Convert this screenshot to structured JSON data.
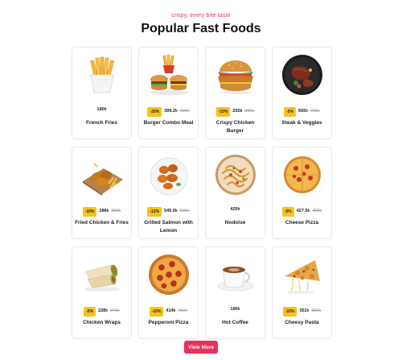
{
  "header": {
    "tagline": "crispy, every bite taste",
    "title": "Popular Fast Foods"
  },
  "products": [
    {
      "name": "French Fries",
      "badge": "",
      "price": "180৳",
      "old_price": "",
      "icon": "fries-image"
    },
    {
      "name": "Burger Combo Meal",
      "badge": "-20%",
      "price": "399.2৳",
      "old_price": "499৳",
      "icon": "burger-combo-image"
    },
    {
      "name": "Crispy Chicken Burger",
      "badge": "-15%",
      "price": "255৳",
      "old_price": "300৳",
      "icon": "chicken-burger-image"
    },
    {
      "name": "Steak & Veggies",
      "badge": "-5%",
      "price": "665৳",
      "old_price": "700৳",
      "icon": "steak-image"
    },
    {
      "name": "Fried Chicken & Fries",
      "badge": "-10%",
      "price": "288৳",
      "old_price": "320৳",
      "icon": "fried-chicken-image"
    },
    {
      "name": "Grilled Salmon with Lemon",
      "badge": "-12%",
      "price": "545.6৳",
      "old_price": "620৳",
      "icon": "grilled-wings-image"
    },
    {
      "name": "Nodolse",
      "badge": "",
      "price": "420৳",
      "old_price": "",
      "icon": "noodles-image"
    },
    {
      "name": "Cheese Pizza",
      "badge": "-5%",
      "price": "427.5৳",
      "old_price": "450৳",
      "icon": "pizza-image"
    },
    {
      "name": "Chicken Wraps",
      "badge": "-5%",
      "price": "228৳",
      "old_price": "240৳",
      "icon": "wraps-image"
    },
    {
      "name": "Pepperoni Pizza",
      "badge": "-10%",
      "price": "414৳",
      "old_price": "460৳",
      "icon": "pepperoni-image"
    },
    {
      "name": "Hot Coffee",
      "badge": "",
      "price": "180৳",
      "old_price": "",
      "icon": "coffee-image"
    },
    {
      "name": "Cheesy Pasta",
      "badge": "-10%",
      "price": "351৳",
      "old_price": "390৳",
      "icon": "pasta-image"
    }
  ],
  "view_more_label": "View More",
  "colors": {
    "accent": "#e8315b",
    "badge": "#f7c21a"
  }
}
